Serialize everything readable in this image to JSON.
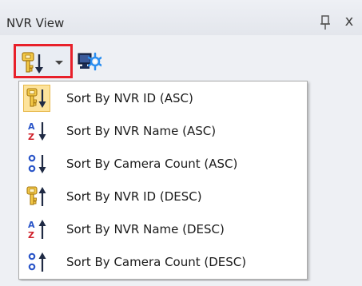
{
  "panel": {
    "title": "NVR View",
    "pin_icon": "pin-icon",
    "close_label": "x"
  },
  "toolbar": {
    "sort_button_icon": "sort-key-down-icon",
    "dropdown_icon": "chevron-down-icon",
    "settings_icon": "nvr-settings-icon",
    "highlight_color": "#e8202a"
  },
  "menu": {
    "items": [
      {
        "label": "Sort By NVR ID (ASC)",
        "icon": "sort-id-asc-icon",
        "checked": true
      },
      {
        "label": "Sort By NVR Name (ASC)",
        "icon": "sort-name-asc-icon",
        "checked": false
      },
      {
        "label": "Sort By Camera Count (ASC)",
        "icon": "sort-count-asc-icon",
        "checked": false
      },
      {
        "label": "Sort By NVR ID (DESC)",
        "icon": "sort-id-desc-icon",
        "checked": false
      },
      {
        "label": "Sort By NVR Name (DESC)",
        "icon": "sort-name-desc-icon",
        "checked": false
      },
      {
        "label": "Sort By Camera Count (DESC)",
        "icon": "sort-count-desc-icon",
        "checked": false
      }
    ]
  },
  "colors": {
    "checked_bg": "#fde39b",
    "key_gold": "#d9a21e",
    "arrow_dark": "#1f2a44",
    "letter_blue": "#2a55c8",
    "letter_red": "#d0202a"
  }
}
